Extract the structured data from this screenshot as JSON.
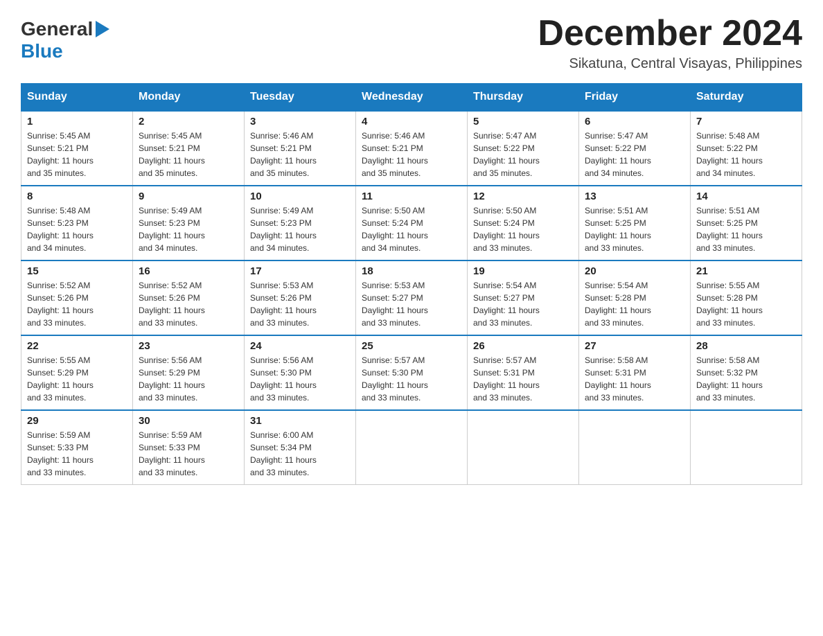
{
  "header": {
    "logo_general": "General",
    "logo_blue": "Blue",
    "month_title": "December 2024",
    "location": "Sikatuna, Central Visayas, Philippines"
  },
  "days_of_week": [
    "Sunday",
    "Monday",
    "Tuesday",
    "Wednesday",
    "Thursday",
    "Friday",
    "Saturday"
  ],
  "weeks": [
    [
      {
        "day": "1",
        "sunrise": "5:45 AM",
        "sunset": "5:21 PM",
        "daylight": "11 hours and 35 minutes."
      },
      {
        "day": "2",
        "sunrise": "5:45 AM",
        "sunset": "5:21 PM",
        "daylight": "11 hours and 35 minutes."
      },
      {
        "day": "3",
        "sunrise": "5:46 AM",
        "sunset": "5:21 PM",
        "daylight": "11 hours and 35 minutes."
      },
      {
        "day": "4",
        "sunrise": "5:46 AM",
        "sunset": "5:21 PM",
        "daylight": "11 hours and 35 minutes."
      },
      {
        "day": "5",
        "sunrise": "5:47 AM",
        "sunset": "5:22 PM",
        "daylight": "11 hours and 35 minutes."
      },
      {
        "day": "6",
        "sunrise": "5:47 AM",
        "sunset": "5:22 PM",
        "daylight": "11 hours and 34 minutes."
      },
      {
        "day": "7",
        "sunrise": "5:48 AM",
        "sunset": "5:22 PM",
        "daylight": "11 hours and 34 minutes."
      }
    ],
    [
      {
        "day": "8",
        "sunrise": "5:48 AM",
        "sunset": "5:23 PM",
        "daylight": "11 hours and 34 minutes."
      },
      {
        "day": "9",
        "sunrise": "5:49 AM",
        "sunset": "5:23 PM",
        "daylight": "11 hours and 34 minutes."
      },
      {
        "day": "10",
        "sunrise": "5:49 AM",
        "sunset": "5:23 PM",
        "daylight": "11 hours and 34 minutes."
      },
      {
        "day": "11",
        "sunrise": "5:50 AM",
        "sunset": "5:24 PM",
        "daylight": "11 hours and 34 minutes."
      },
      {
        "day": "12",
        "sunrise": "5:50 AM",
        "sunset": "5:24 PM",
        "daylight": "11 hours and 33 minutes."
      },
      {
        "day": "13",
        "sunrise": "5:51 AM",
        "sunset": "5:25 PM",
        "daylight": "11 hours and 33 minutes."
      },
      {
        "day": "14",
        "sunrise": "5:51 AM",
        "sunset": "5:25 PM",
        "daylight": "11 hours and 33 minutes."
      }
    ],
    [
      {
        "day": "15",
        "sunrise": "5:52 AM",
        "sunset": "5:26 PM",
        "daylight": "11 hours and 33 minutes."
      },
      {
        "day": "16",
        "sunrise": "5:52 AM",
        "sunset": "5:26 PM",
        "daylight": "11 hours and 33 minutes."
      },
      {
        "day": "17",
        "sunrise": "5:53 AM",
        "sunset": "5:26 PM",
        "daylight": "11 hours and 33 minutes."
      },
      {
        "day": "18",
        "sunrise": "5:53 AM",
        "sunset": "5:27 PM",
        "daylight": "11 hours and 33 minutes."
      },
      {
        "day": "19",
        "sunrise": "5:54 AM",
        "sunset": "5:27 PM",
        "daylight": "11 hours and 33 minutes."
      },
      {
        "day": "20",
        "sunrise": "5:54 AM",
        "sunset": "5:28 PM",
        "daylight": "11 hours and 33 minutes."
      },
      {
        "day": "21",
        "sunrise": "5:55 AM",
        "sunset": "5:28 PM",
        "daylight": "11 hours and 33 minutes."
      }
    ],
    [
      {
        "day": "22",
        "sunrise": "5:55 AM",
        "sunset": "5:29 PM",
        "daylight": "11 hours and 33 minutes."
      },
      {
        "day": "23",
        "sunrise": "5:56 AM",
        "sunset": "5:29 PM",
        "daylight": "11 hours and 33 minutes."
      },
      {
        "day": "24",
        "sunrise": "5:56 AM",
        "sunset": "5:30 PM",
        "daylight": "11 hours and 33 minutes."
      },
      {
        "day": "25",
        "sunrise": "5:57 AM",
        "sunset": "5:30 PM",
        "daylight": "11 hours and 33 minutes."
      },
      {
        "day": "26",
        "sunrise": "5:57 AM",
        "sunset": "5:31 PM",
        "daylight": "11 hours and 33 minutes."
      },
      {
        "day": "27",
        "sunrise": "5:58 AM",
        "sunset": "5:31 PM",
        "daylight": "11 hours and 33 minutes."
      },
      {
        "day": "28",
        "sunrise": "5:58 AM",
        "sunset": "5:32 PM",
        "daylight": "11 hours and 33 minutes."
      }
    ],
    [
      {
        "day": "29",
        "sunrise": "5:59 AM",
        "sunset": "5:33 PM",
        "daylight": "11 hours and 33 minutes."
      },
      {
        "day": "30",
        "sunrise": "5:59 AM",
        "sunset": "5:33 PM",
        "daylight": "11 hours and 33 minutes."
      },
      {
        "day": "31",
        "sunrise": "6:00 AM",
        "sunset": "5:34 PM",
        "daylight": "11 hours and 33 minutes."
      },
      null,
      null,
      null,
      null
    ]
  ],
  "labels": {
    "sunrise": "Sunrise:",
    "sunset": "Sunset:",
    "daylight": "Daylight:"
  }
}
